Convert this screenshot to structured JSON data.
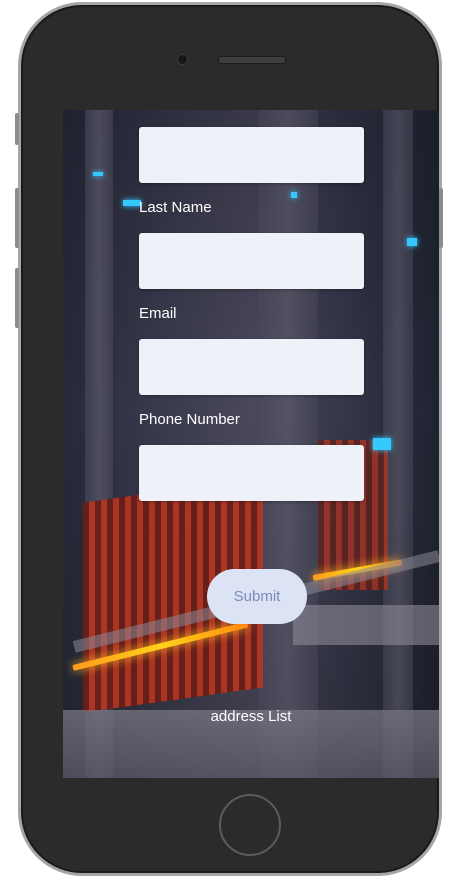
{
  "form": {
    "fields": [
      {
        "label": "",
        "value": ""
      },
      {
        "label": "Last Name",
        "value": ""
      },
      {
        "label": "Email",
        "value": ""
      },
      {
        "label": "Phone Number",
        "value": ""
      }
    ],
    "submit_label": "Submit"
  },
  "footer": {
    "link_label": "address List"
  },
  "colors": {
    "field_bg": "#eef2f8",
    "submit_bg": "#dce3f4",
    "submit_text": "#7c8cb7",
    "label_text": "#ffffff"
  },
  "icons": [
    "camera-icon",
    "speaker-grille-icon",
    "home-button-icon"
  ]
}
